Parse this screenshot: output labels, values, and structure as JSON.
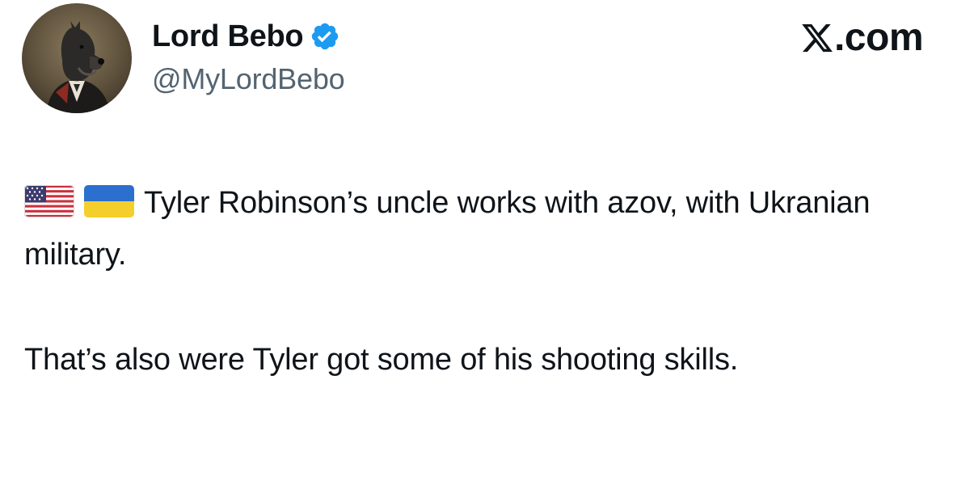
{
  "author": {
    "display_name": "Lord Bebo",
    "handle": "@MyLordBebo",
    "avatar_icon": "dog-portrait-avatar",
    "verified_icon": "verified-badge-icon",
    "verified_color": "#1d9bf0"
  },
  "brand": {
    "icon": "x-logo-icon",
    "suffix": ".com"
  },
  "post": {
    "flags": [
      "us-flag-icon",
      "ukraine-flag-icon"
    ],
    "paragraph_1": "Tyler Robinson’s uncle works with azov, with Ukranian military.",
    "paragraph_2": "That’s also were Tyler got some of his shooting skills."
  },
  "colors": {
    "text": "#0f1419",
    "secondary_text": "#536471",
    "background": "#ffffff"
  }
}
